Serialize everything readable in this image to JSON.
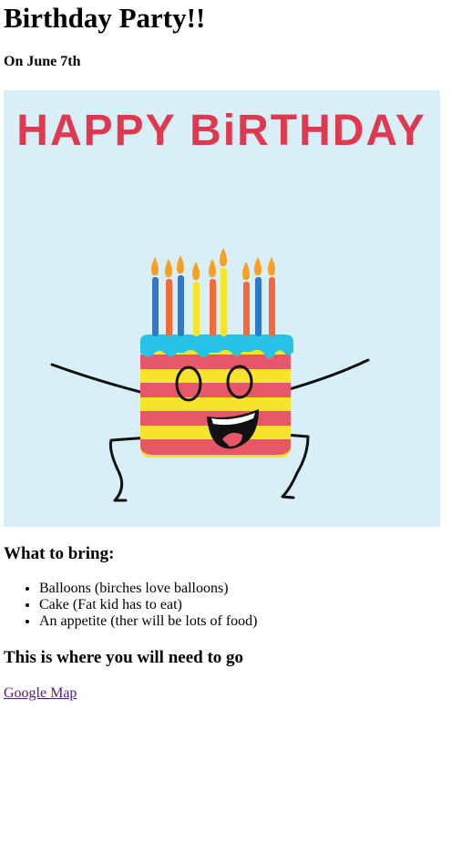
{
  "title": "Birthday Party!!",
  "date": "On June 7th",
  "card": {
    "banner_text": "HAPPY BiRTHDAY",
    "background_color": "#d9eff7",
    "banner_color": "#e0384f",
    "candle_colors": [
      "#2f7ac6",
      "#f06a3b",
      "#2f7ac6",
      "#f6e42b",
      "#f06a3b",
      "#f6e42b",
      "#f06a3b",
      "#2f7ac6",
      "#f06a3b"
    ],
    "icing_color": "#27c3e6",
    "stripe_colors": [
      "#e8566a",
      "#f6e42b"
    ]
  },
  "bring": {
    "heading": "What to bring:",
    "items": [
      "Balloons (birches love balloons)",
      "Cake (Fat kid has to eat)",
      "An appetite (ther will be lots of food)"
    ]
  },
  "where": {
    "heading": "This is where you will need to go",
    "link_label": "Google Map"
  }
}
